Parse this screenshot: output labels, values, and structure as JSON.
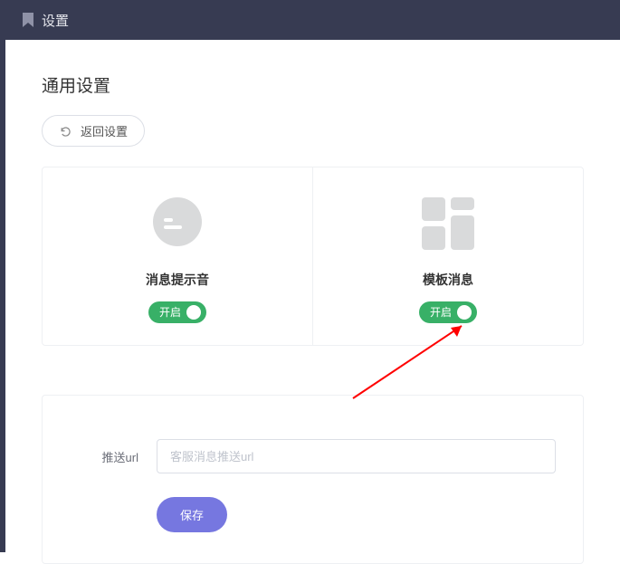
{
  "topbar": {
    "title": "设置"
  },
  "section": {
    "title": "通用设置"
  },
  "back_button": {
    "label": "返回设置"
  },
  "cards": {
    "sound": {
      "label": "消息提示音",
      "toggle_text": "开启"
    },
    "template": {
      "label": "模板消息",
      "toggle_text": "开启"
    }
  },
  "form": {
    "push_url": {
      "label": "推送url",
      "placeholder": "客服消息推送url"
    },
    "save_button": "保存"
  },
  "colors": {
    "toggle_green": "#38b067",
    "primary": "#7677e0",
    "header_bg": "#373b52"
  }
}
